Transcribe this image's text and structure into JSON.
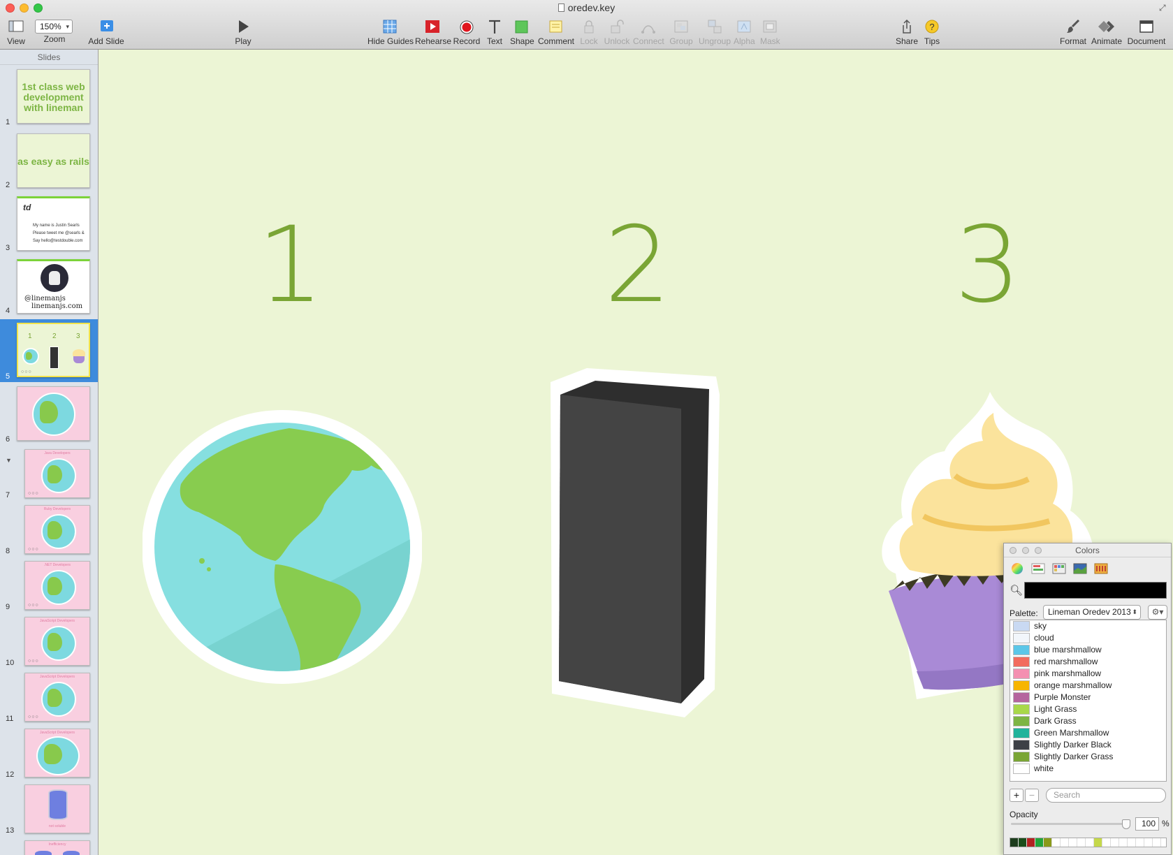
{
  "window": {
    "title": "oredev.key"
  },
  "toolbar": {
    "view_label": "View",
    "zoom_value": "150%",
    "zoom_label": "Zoom",
    "add_slide_label": "Add Slide",
    "play_label": "Play",
    "hide_guides_label": "Hide Guides",
    "rehearse_label": "Rehearse",
    "record_label": "Record",
    "text_label": "Text",
    "shape_label": "Shape",
    "comment_label": "Comment",
    "lock_label": "Lock",
    "unlock_label": "Unlock",
    "connect_label": "Connect",
    "group_label": "Group",
    "ungroup_label": "Ungroup",
    "alpha_label": "Alpha",
    "mask_label": "Mask",
    "share_label": "Share",
    "tips_label": "Tips",
    "format_label": "Format",
    "animate_label": "Animate",
    "document_label": "Document"
  },
  "sidebar": {
    "header": "Slides",
    "slides": [
      {
        "number": "1",
        "text_line1": "1st class web",
        "text_line2": "development",
        "text_line3": "with lineman"
      },
      {
        "number": "2",
        "text": "as easy as rails"
      },
      {
        "number": "3",
        "line1": "My name is Justin Searls",
        "line2": "Please tweet me @searls &",
        "line3": "Say hello@testdouble.com",
        "logo": "td"
      },
      {
        "number": "4",
        "line1": "@linemanjs",
        "line2": "linemanjs.com"
      },
      {
        "number": "5",
        "labels": [
          "1",
          "2",
          "3"
        ]
      },
      {
        "number": "6"
      },
      {
        "number": "7",
        "caption": "Java Developers"
      },
      {
        "number": "8",
        "caption": "Ruby Developers"
      },
      {
        "number": "9",
        "caption": ".NET Developers"
      },
      {
        "number": "10",
        "caption": "JavaScript Developers"
      },
      {
        "number": "11",
        "caption": "JavaScript Developers"
      },
      {
        "number": "12",
        "caption": "JavaScript Developers"
      },
      {
        "number": "13",
        "caption": "not soluble"
      },
      {
        "number": "",
        "caption": "Inefficiency"
      }
    ],
    "build_dots": "○○○"
  },
  "canvas": {
    "numbers": [
      "1",
      "2",
      "3"
    ]
  },
  "colors_panel": {
    "title": "Colors",
    "palette_label": "Palette:",
    "palette_value": "Lineman Oredev 2013",
    "colors": [
      {
        "name": "sky",
        "hex": "#c9d9f2"
      },
      {
        "name": "cloud",
        "hex": "#f2f6fb"
      },
      {
        "name": "blue marshmallow",
        "hex": "#5bc6e8"
      },
      {
        "name": "red marshmallow",
        "hex": "#f26b5e"
      },
      {
        "name": "pink marshmallow",
        "hex": "#f48fb1"
      },
      {
        "name": "orange marshmallow",
        "hex": "#f7b500"
      },
      {
        "name": "Purple Monster",
        "hex": "#b5659e"
      },
      {
        "name": "Light Grass",
        "hex": "#a8d84a"
      },
      {
        "name": "Dark Grass",
        "hex": "#7db544"
      },
      {
        "name": "Green Marshmallow",
        "hex": "#21b39b"
      },
      {
        "name": "Slightly Darker Black",
        "hex": "#3d4046"
      },
      {
        "name": "Slightly Darker Grass",
        "hex": "#7aa535"
      },
      {
        "name": "white",
        "hex": "#ffffff"
      }
    ],
    "search_placeholder": "Search",
    "opacity_label": "Opacity",
    "opacity_value": "100",
    "opacity_unit": "%",
    "opacity_fraction": 1.0,
    "strip_colors": [
      "#1d3d1d",
      "#1b4d1b",
      "#b22222",
      "#23a33a",
      "#8a9a1a",
      "#ffffff",
      "#ffffff",
      "#ffffff",
      "#ffffff",
      "#ffffff",
      "#c5d84a",
      "#ffffff",
      "#ffffff",
      "#ffffff",
      "#ffffff",
      "#ffffff",
      "#ffffff",
      "#ffffff"
    ]
  }
}
